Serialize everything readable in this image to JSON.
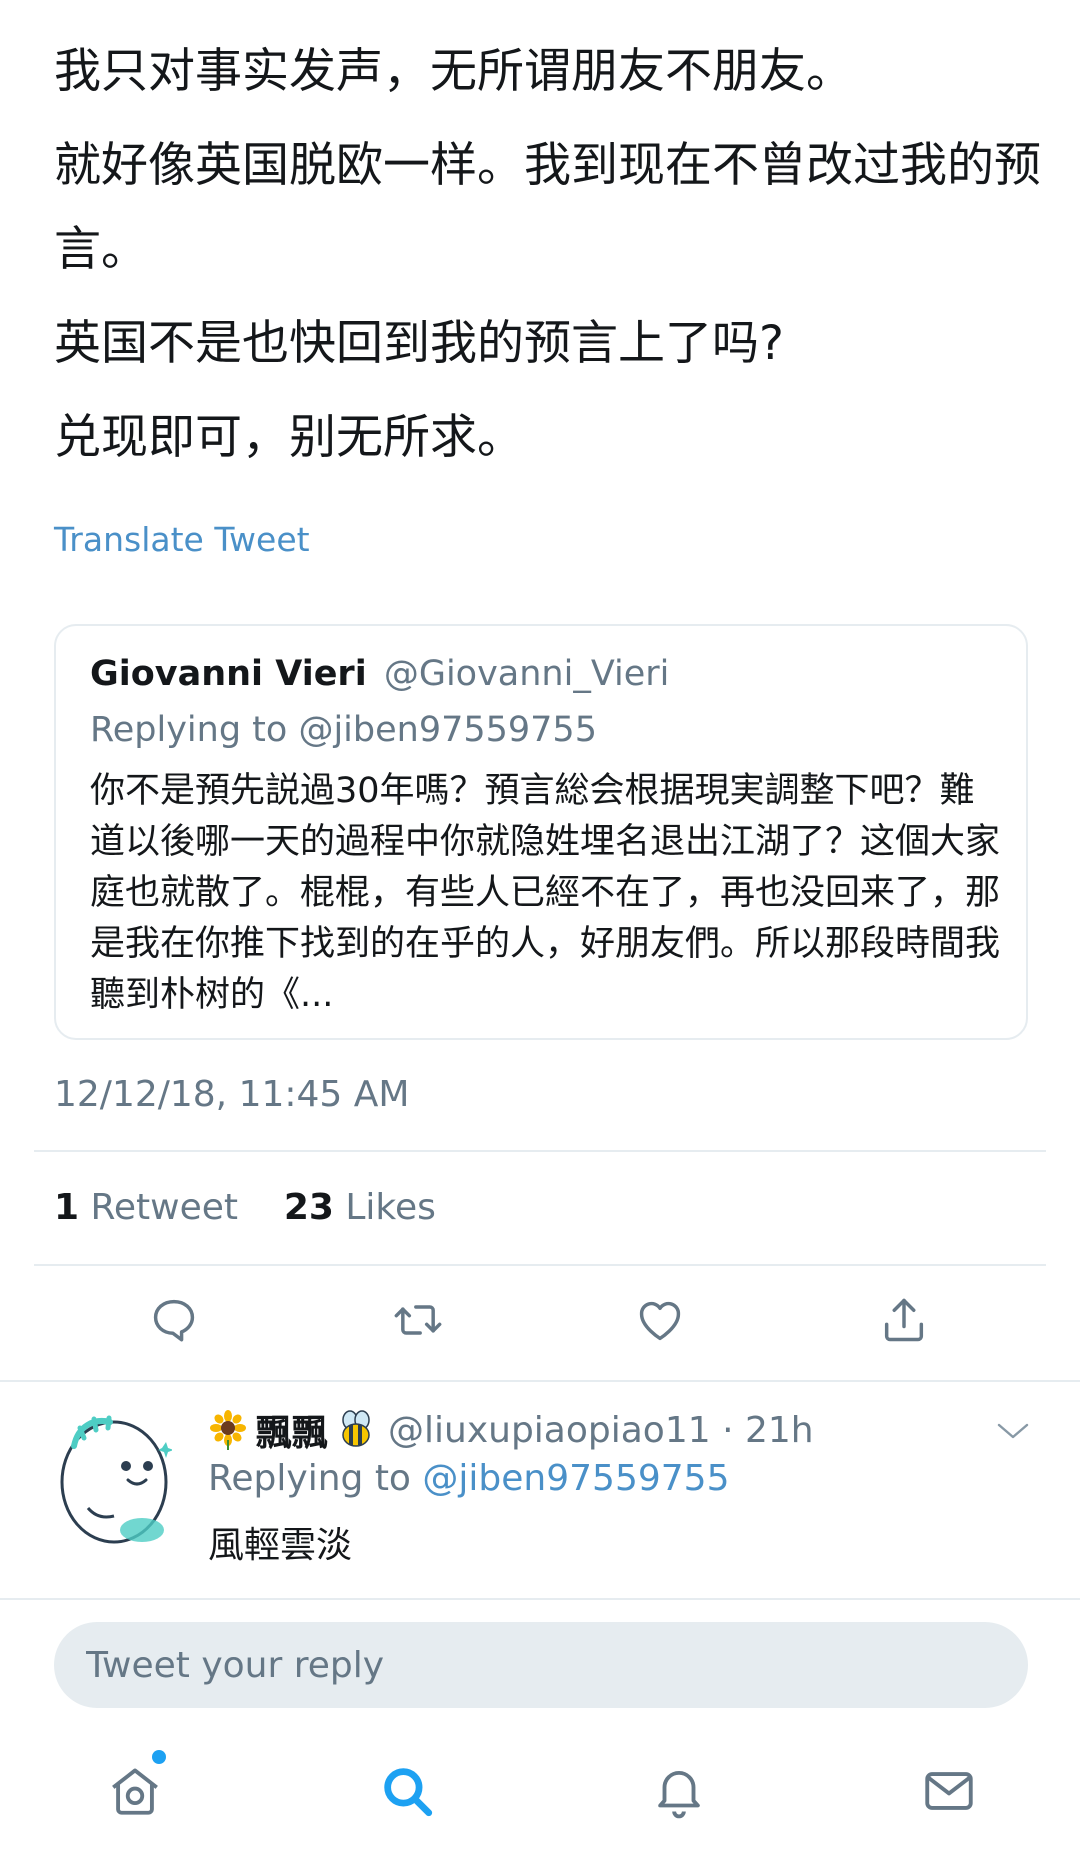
{
  "tweet": {
    "paragraphs": [
      "我只对事实发声，无所谓朋友不朋友。",
      "就好像英国脱欧一样。我到现在不曾改过我的预言。",
      "英国不是也快回到我的预言上了吗?",
      "兑现即可，别无所求。"
    ],
    "translate_label": "Translate Tweet",
    "timestamp": "12/12/18, 11:45 AM",
    "stats": {
      "retweets_count": "1",
      "retweets_label": "Retweet",
      "likes_count": "23",
      "likes_label": "Likes"
    }
  },
  "quoted_tweet": {
    "name": "Giovanni Vieri",
    "handle": "@Giovanni_Vieri",
    "replying_to": "Replying to @jiben97559755",
    "text": "你不是預先説過30年嗎？預言総会根据現実調整下吧？難道以後哪一天的過程中你就隐姓埋名退出江湖了？这個大家庭也就散了。棍棍，有些人已經不在了，再也没回来了，那是我在你推下找到的在乎的人，好朋友們。所以那段時間我聽到朴树的《..."
  },
  "actions": [
    {
      "icon": "reply-icon"
    },
    {
      "icon": "retweet-icon"
    },
    {
      "icon": "like-icon"
    },
    {
      "icon": "share-icon"
    }
  ],
  "reply": {
    "name": "飄飄",
    "handle_time": "@liuxupiaopiao11 · 21h",
    "replying_prefix": "Replying to",
    "replying_mention": "@jiben97559755",
    "text": "風輕雲淡"
  },
  "compose": {
    "placeholder": "Tweet your reply"
  },
  "tabbar": {
    "items": [
      "home-icon",
      "search-icon",
      "notifications-icon",
      "messages-icon"
    ],
    "active": "search-icon",
    "colors": {
      "active": "#1da1f2",
      "inactive": "#657786"
    }
  }
}
